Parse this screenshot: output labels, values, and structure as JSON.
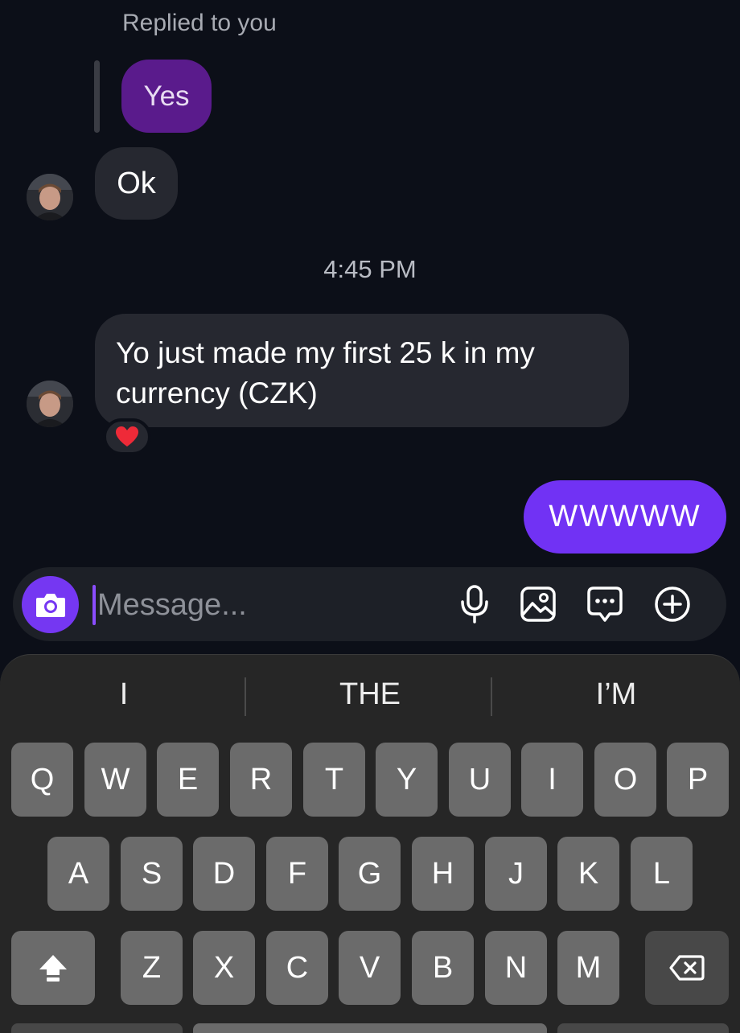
{
  "chat": {
    "replied_label": "Replied to you",
    "quoted_message": "Yes",
    "messages": [
      {
        "direction": "incoming",
        "text": "Ok"
      },
      {
        "direction": "incoming",
        "text_line1": "Yo just made my first 25 k in my",
        "text_line2": "currency (CZK)",
        "reaction": "❤️"
      },
      {
        "direction": "outgoing",
        "text": "WWWWW"
      }
    ],
    "timestamp": "4:45 PM"
  },
  "composer": {
    "placeholder": "Message...",
    "icons": [
      "camera-icon",
      "microphone-icon",
      "image-icon",
      "sticker-chat-icon",
      "plus-circle-icon"
    ]
  },
  "keyboard": {
    "suggestions": [
      "I",
      "THE",
      "I’M"
    ],
    "row1": [
      "Q",
      "W",
      "E",
      "R",
      "T",
      "Y",
      "U",
      "I",
      "O",
      "P"
    ],
    "row2": [
      "A",
      "S",
      "D",
      "F",
      "G",
      "H",
      "J",
      "K",
      "L"
    ],
    "row3": [
      "Z",
      "X",
      "C",
      "V",
      "B",
      "N",
      "M"
    ],
    "special_icons": [
      "shift-icon",
      "backspace-icon"
    ]
  },
  "colors": {
    "background": "#0c0f18",
    "incoming_bubble": "#262830",
    "outgoing_bubble": "#7132f4",
    "quoted_bubble": "#5a1b8c",
    "accent": "#7537f2"
  }
}
